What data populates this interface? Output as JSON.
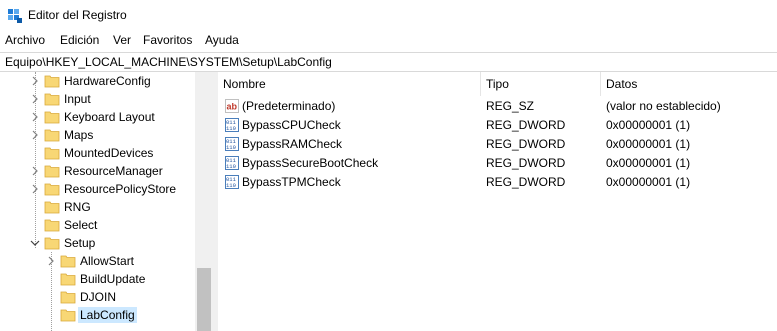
{
  "window": {
    "title": "Editor del Registro"
  },
  "menu": {
    "items": [
      "Archivo",
      "Edición",
      "Ver",
      "Favoritos",
      "Ayuda"
    ]
  },
  "address": {
    "path": "Equipo\\HKEY_LOCAL_MACHINE\\SYSTEM\\Setup\\LabConfig"
  },
  "tree": {
    "items": [
      {
        "label": "HardwareConfig"
      },
      {
        "label": "Input"
      },
      {
        "label": "Keyboard Layout"
      },
      {
        "label": "Maps"
      },
      {
        "label": "MountedDevices"
      },
      {
        "label": "ResourceManager"
      },
      {
        "label": "ResourcePolicyStore"
      },
      {
        "label": "RNG"
      },
      {
        "label": "Select"
      },
      {
        "label": "Setup",
        "expanded": true
      },
      {
        "label": "AllowStart"
      },
      {
        "label": "BuildUpdate"
      },
      {
        "label": "DJOIN"
      },
      {
        "label": "LabConfig",
        "selected": true
      }
    ]
  },
  "list": {
    "columns": [
      "Nombre",
      "Tipo",
      "Datos"
    ],
    "rows": [
      {
        "name": "(Predeterminado)",
        "type": "REG_SZ",
        "data": "(valor no establecido)",
        "icon": "string-value-icon"
      },
      {
        "name": "BypassCPUCheck",
        "type": "REG_DWORD",
        "data": "0x00000001 (1)",
        "icon": "dword-value-icon"
      },
      {
        "name": "BypassRAMCheck",
        "type": "REG_DWORD",
        "data": "0x00000001 (1)",
        "icon": "dword-value-icon"
      },
      {
        "name": "BypassSecureBootCheck",
        "type": "REG_DWORD",
        "data": "0x00000001 (1)",
        "icon": "dword-value-icon"
      },
      {
        "name": "BypassTPMCheck",
        "type": "REG_DWORD",
        "data": "0x00000001 (1)",
        "icon": "dword-value-icon"
      }
    ]
  },
  "colors": {
    "selection": "#cce8ff",
    "folder": "#f8d775",
    "accent": "#0078d7"
  }
}
